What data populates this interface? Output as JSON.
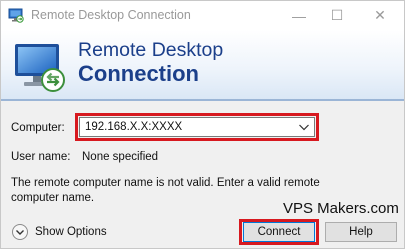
{
  "window": {
    "title": "Remote Desktop Connection",
    "minimize_glyph": "—",
    "maximize_glyph": "☐",
    "close_glyph": "✕"
  },
  "banner": {
    "line1": "Remote Desktop",
    "line2": "Connection"
  },
  "form": {
    "computer_label": "Computer:",
    "computer_value": "192.168.X.X:XXXX",
    "username_label": "User name:",
    "username_value": "None specified",
    "message": "The remote computer name is not valid. Enter a valid remote computer name."
  },
  "footer": {
    "show_options_label": "Show Options",
    "watermark": "VPS Makers.com",
    "connect_label": "Connect",
    "help_label": "Help"
  },
  "colors": {
    "highlight": "#d7191f",
    "banner_text": "#1b3f8a"
  },
  "icons": [
    "rdp-app-icon",
    "rdp-monitor-icon",
    "chevron-down-icon",
    "options-expand-icon"
  ]
}
